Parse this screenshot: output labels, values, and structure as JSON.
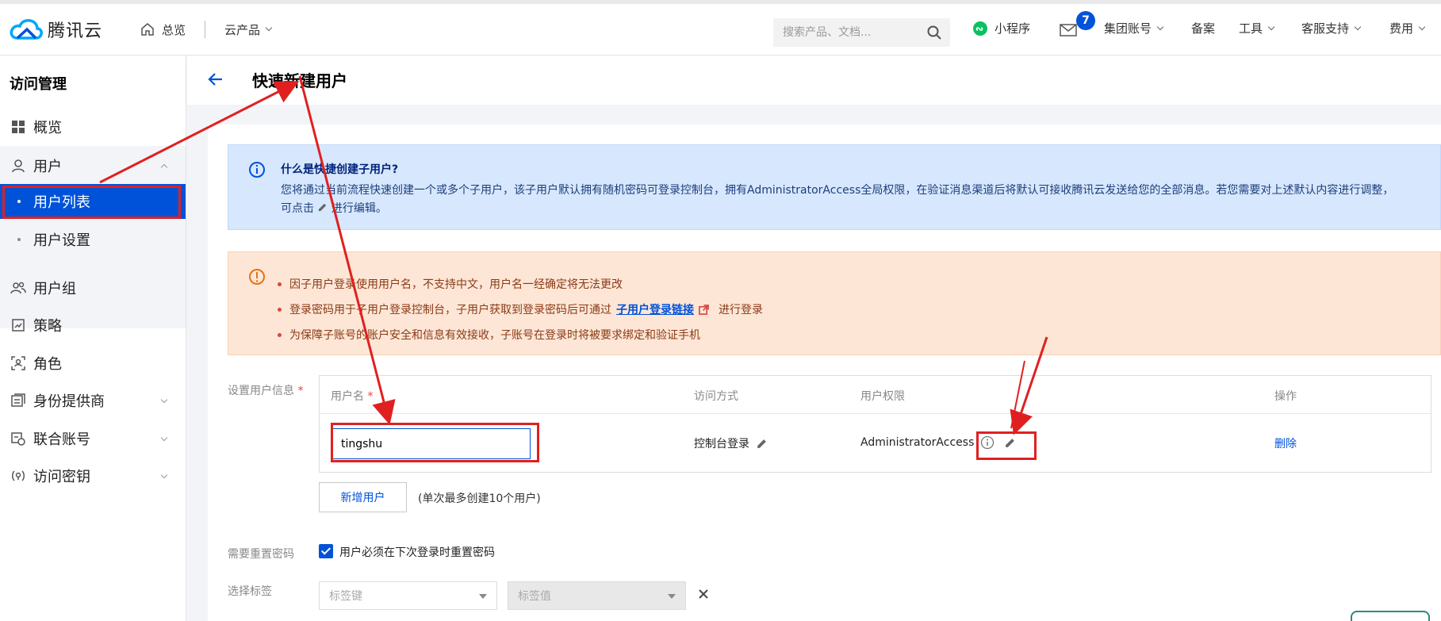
{
  "topbar": {
    "logo_text": "腾讯云",
    "home_label": "总览",
    "products_label": "云产品",
    "search_placeholder": "搜索产品、文档...",
    "mini_program_label": "小程序",
    "message_count": "7",
    "group_account_label": "集团账号",
    "filing_label": "备案",
    "tools_label": "工具",
    "support_label": "客服支持",
    "billing_label": "费用",
    "brand_color": "#0052d9"
  },
  "sidebar": {
    "title": "访问管理",
    "items": [
      {
        "label": "概览",
        "icon": "grid-icon"
      },
      {
        "label": "用户",
        "icon": "user-icon"
      },
      {
        "label": "用户列表",
        "icon": "dot"
      },
      {
        "label": "用户设置",
        "icon": "dot"
      },
      {
        "label": "用户组",
        "icon": "user-group-icon"
      },
      {
        "label": "策略",
        "icon": "policy-icon"
      },
      {
        "label": "角色",
        "icon": "role-icon"
      },
      {
        "label": "身份提供商",
        "icon": "identity-provider-icon"
      },
      {
        "label": "联合账号",
        "icon": "federated-account-icon"
      },
      {
        "label": "访问密钥",
        "icon": "key-icon"
      }
    ]
  },
  "main": {
    "title": "快速新建用户",
    "info": {
      "title": "什么是快捷创建子用户?",
      "text_before_icon": "您将通过当前流程快速创建一个或多个子用户，该子用户默认拥有随机密码可登录控制台，拥有AdministratorAccess全局权限，在验证消息渠道后将默认可接收腾讯云发送给您的全部消息。若您需要对上述默认内容进行调整，可点击",
      "text_after_icon": "进行编辑。"
    },
    "warnings": {
      "line1": "因子用户登录使用用户名，不支持中文，用户名一经确定将无法更改",
      "line2_before": "登录密码用于子用户登录控制台，子用户获取到登录密码后可通过",
      "line2_link": "子用户登录链接",
      "line2_after": "进行登录",
      "line3": "为保障子账号的账户安全和信息有效接收，子账号在登录时将被要求绑定和验证手机"
    },
    "form": {
      "user_info_label": "设置用户信息",
      "required_mark": "*",
      "table": {
        "col_username": "用户名",
        "col_access": "访问方式",
        "col_permission": "用户权限",
        "col_action": "操作",
        "row": {
          "username": "tingshu",
          "access": "控制台登录",
          "permission": "AdministratorAccess",
          "action": "删除"
        }
      },
      "add_button": "新增用户",
      "add_hint": "(单次最多创建10个用户)",
      "reset_label": "需要重置密码",
      "reset_checkbox_label": "用户必须在下次登录时重置密码",
      "reset_checked": true,
      "tag_label": "选择标签",
      "tag_key_placeholder": "标签键",
      "tag_value_placeholder": "标签值"
    }
  },
  "annotation_color": "#e02020"
}
